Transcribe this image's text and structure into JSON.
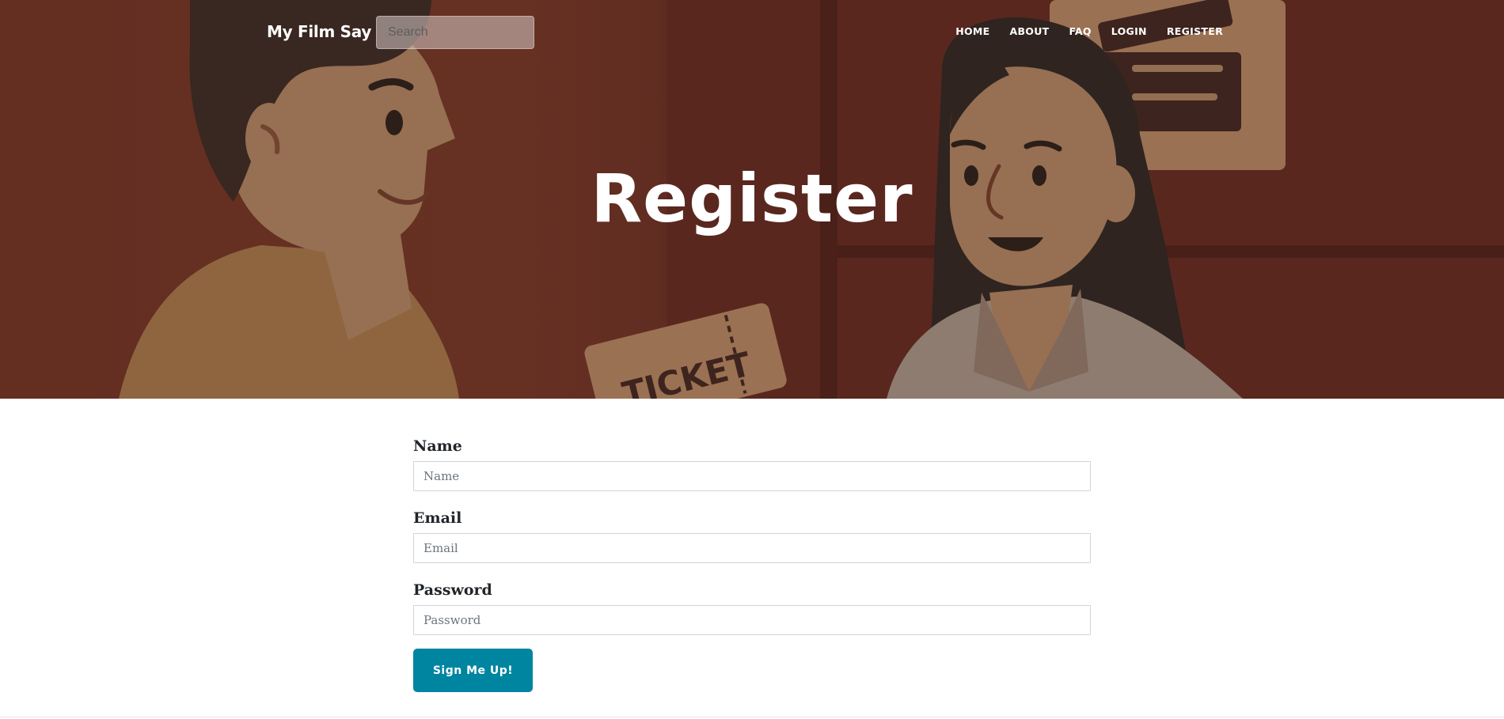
{
  "nav": {
    "brand": "My Film Say",
    "search_placeholder": "Search",
    "links": [
      "HOME",
      "ABOUT",
      "FAQ",
      "LOGIN",
      "REGISTER"
    ]
  },
  "hero": {
    "title": "Register",
    "ticket_text": "TICKET"
  },
  "form": {
    "name_label": "Name",
    "name_placeholder": "Name",
    "email_label": "Email",
    "email_placeholder": "Email",
    "password_label": "Password",
    "password_placeholder": "Password",
    "submit_label": "Sign Me Up!"
  },
  "colors": {
    "hero_background": "#6a3224",
    "button": "#0085a1",
    "text": "#212529"
  }
}
